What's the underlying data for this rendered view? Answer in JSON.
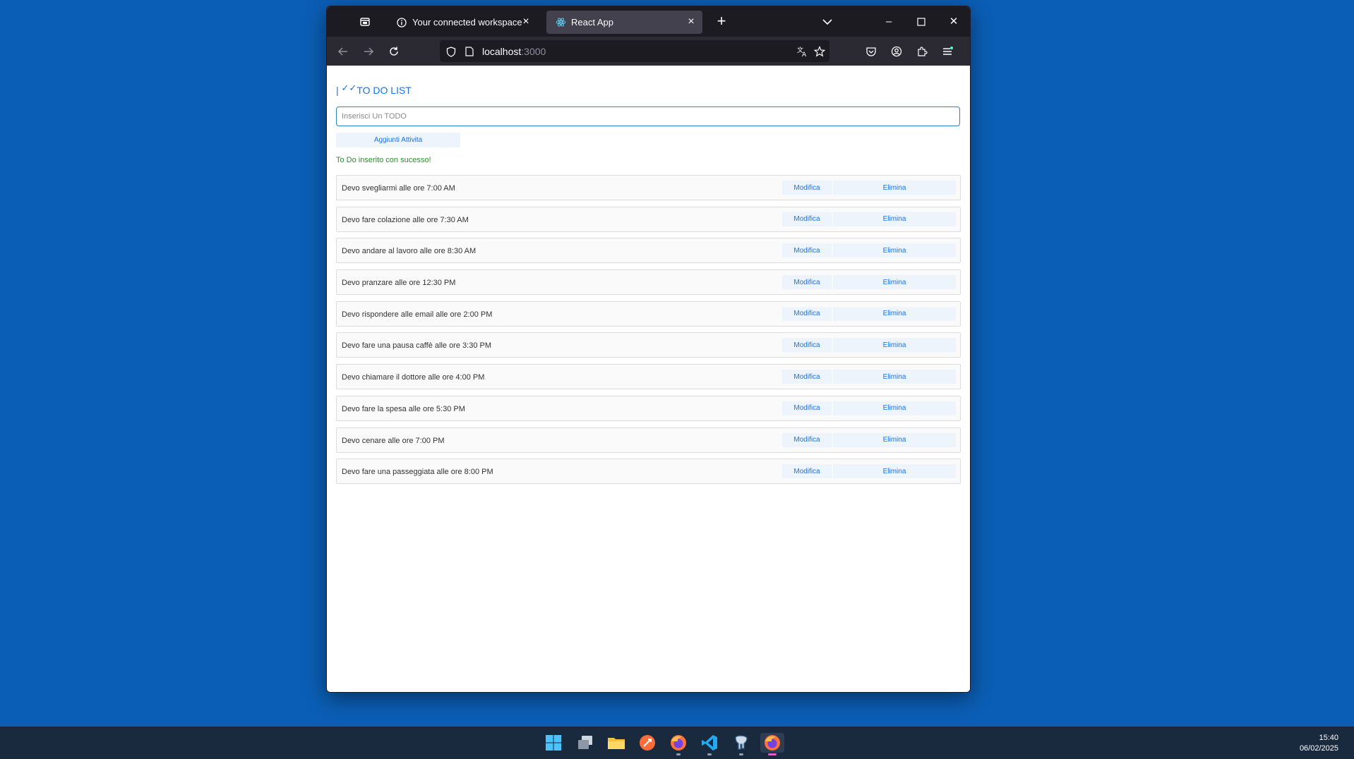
{
  "browser": {
    "tabs": [
      {
        "label": "Your connected workspace for wiki, docs & projects",
        "active": false,
        "close": "×"
      },
      {
        "label": "React App",
        "active": true,
        "close": "×"
      }
    ],
    "new_tab": "+",
    "window_controls": {
      "minimize": "–",
      "maximize": "☐",
      "close": "✕"
    },
    "url": {
      "host": "localhost",
      "port": ":3000"
    }
  },
  "app": {
    "title_prefix": "|",
    "title_check": "✓✓",
    "title": "TO DO LIST",
    "input_placeholder": "Inserisci Un TODO",
    "input_value": "",
    "add_button": "Aggiunti Attivita",
    "success_message": "To Do inserito con sucesso!",
    "modify_label": "Modifica",
    "delete_label": "Elimina",
    "todos": [
      "Devo svegliarmi alle ore 7:00 AM",
      "Devo fare colazione alle ore 7:30 AM",
      "Devo andare al lavoro alle ore 8:30 AM",
      "Devo pranzare alle ore 12:30 PM",
      "Devo rispondere alle email alle ore 2:00 PM",
      "Devo fare una pausa caffè alle ore 3:30 PM",
      "Devo chiamare il dottore alle ore 4:00 PM",
      "Devo fare la spesa alle ore 5:30 PM",
      "Devo cenare alle ore 7:00 PM",
      "Devo fare una passeggiata alle ore 8:00 PM"
    ]
  },
  "taskbar": {
    "time": "15:40",
    "date": "06/02/2025"
  },
  "colors": {
    "desktop": "#0b5eb5",
    "accent": "#1a73e8",
    "success": "#2e8b2e"
  }
}
